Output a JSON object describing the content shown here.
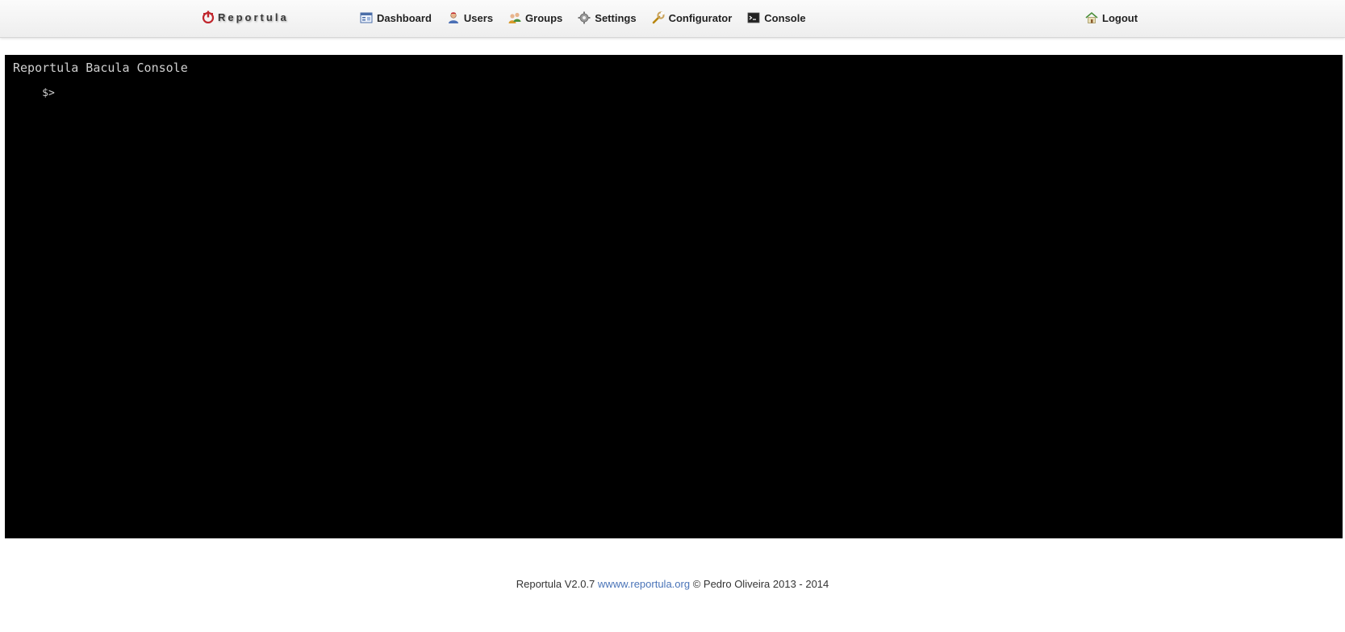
{
  "header": {
    "brand": {
      "label": "Reportula",
      "icon": "reportula-logo-icon"
    },
    "nav": [
      {
        "label": "Dashboard",
        "icon": "dashboard-icon"
      },
      {
        "label": "Users",
        "icon": "user-icon"
      },
      {
        "label": "Groups",
        "icon": "groups-icon"
      },
      {
        "label": "Settings",
        "icon": "gear-icon"
      },
      {
        "label": "Configurator",
        "icon": "wrench-icon"
      },
      {
        "label": "Console",
        "icon": "terminal-icon"
      }
    ],
    "logout": {
      "label": "Logout",
      "icon": "home-icon"
    }
  },
  "console": {
    "banner": "Reportula Bacula Console",
    "prompt": "$>",
    "input_value": ""
  },
  "footer": {
    "version_text": "Reportula V2.0.7",
    "link_text": "wwww.reportula.org",
    "copyright_text": "© Pedro Oliveira 2013 - 2014"
  },
  "colors": {
    "console_bg": "#000000",
    "console_text": "#cfcfcf",
    "link": "#4a74b8",
    "brand_red": "#c0262d"
  }
}
